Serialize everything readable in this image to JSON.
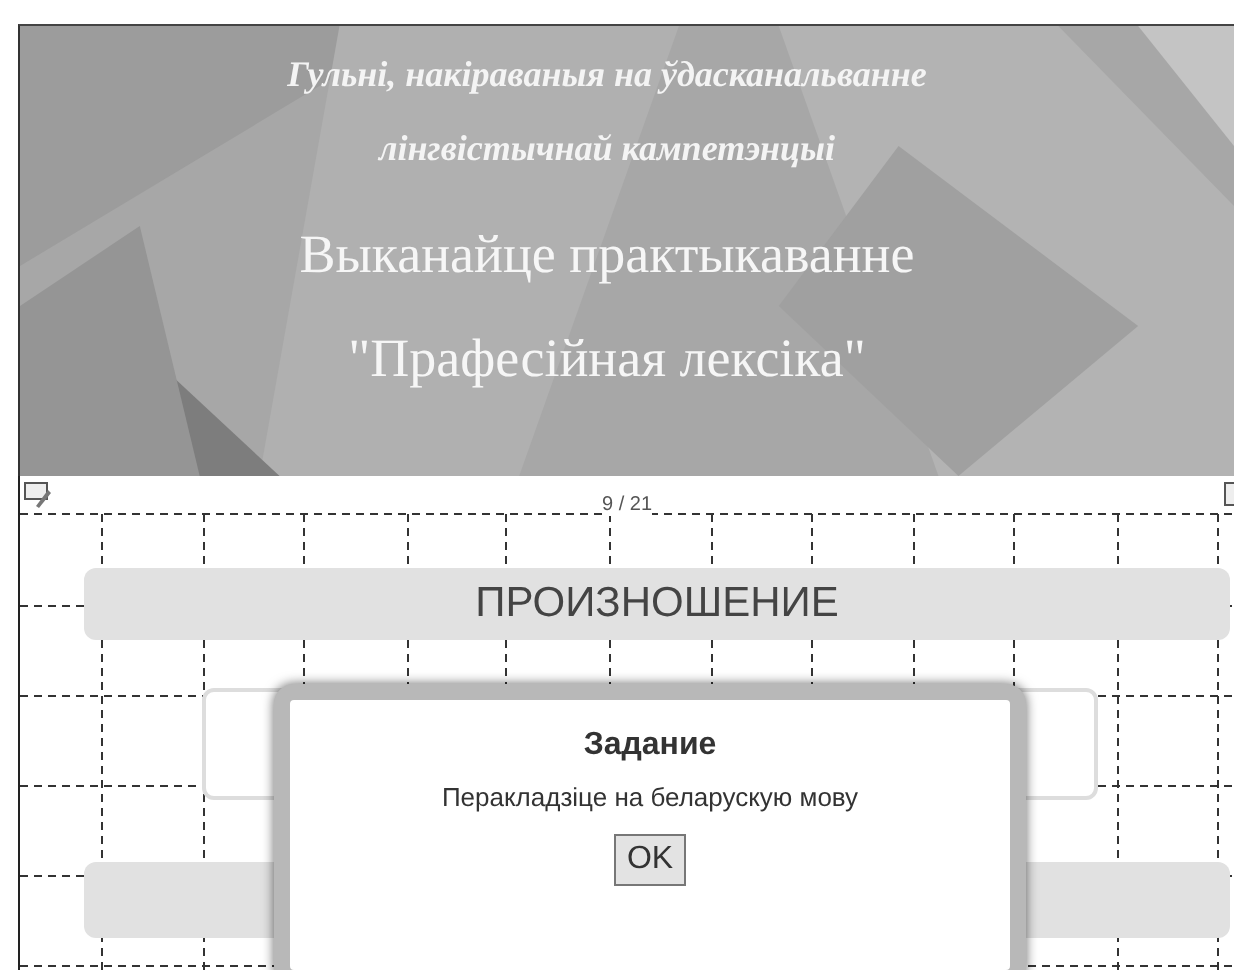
{
  "banner": {
    "subtitle_lines": [
      "Гульні, накіраваныя на ўдасканальванне",
      "лінгвістычнай кампетэнцыі"
    ],
    "title_lines": [
      "Выканайце практыкаванне",
      "\"Прафесійная лексіка\""
    ]
  },
  "page_counter": "9 / 21",
  "heading": "ПРОИЗНОШЕНИЕ",
  "dialog": {
    "title": "Задание",
    "message": "Перакладзіце на беларускую мову",
    "button": "OK"
  }
}
